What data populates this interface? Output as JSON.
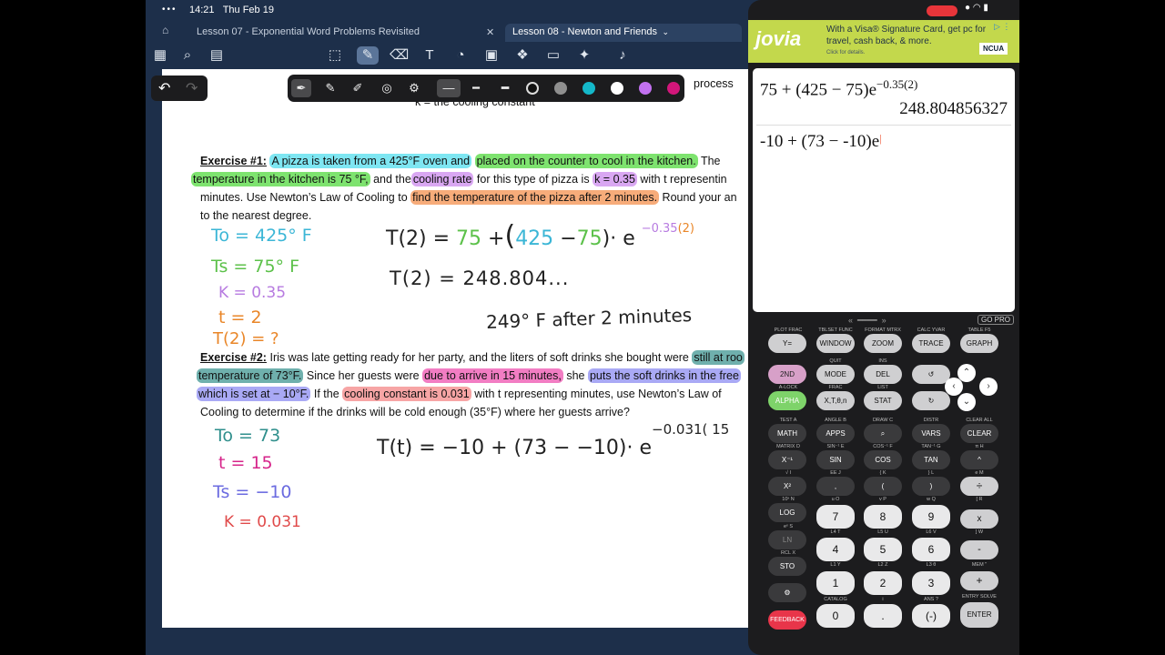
{
  "status": {
    "time": "14:21",
    "date": "Thu Feb 19"
  },
  "tabs": [
    {
      "label": "Lesson 07 - Exponential Word Problems Revisited"
    },
    {
      "label": "Lesson 08 - Newton and Friends"
    }
  ],
  "doc": {
    "top_line_a": "process",
    "top_line_b": "k = the cooling constant",
    "ex1": {
      "label": "Exercise #1:",
      "l1_a": "A pizza is taken from a 425°F oven and",
      "l1_b": "placed on the counter to cool in the kitchen.",
      "l1_c": "The",
      "l2_a": "temperature in the kitchen is 75 °F,",
      "l2_b": "and the",
      "l2_c": "cooling rate",
      "l2_d": "for this type of pizza is",
      "l2_e": "k = 0.35",
      "l2_f": "with t representin",
      "l3_a": "minutes. Use Newton’s Law of Cooling to",
      "l3_b": "find the temperature of the pizza after 2 minutes.",
      "l3_c": "Round your an",
      "l4": "to the nearest degree."
    },
    "ex2": {
      "label": "Exercise #2:",
      "l1_a": "Iris was late getting ready for her party, and the liters of soft drinks she bought were",
      "l1_b": "still at roo",
      "l2_a": "temperature of 73°F.",
      "l2_b": "Since her guests were",
      "l2_c": "due to arrive in 15 minutes,",
      "l2_d": "she",
      "l2_e": "puts the soft drinks in the free",
      "l3_a": "which is set at − 10°F.",
      "l3_b": "If the",
      "l3_c": "cooling constant is 0.031",
      "l3_d": "with t representing minutes, use Newton’s Law of",
      "l4": "Cooling to determine if the drinks will be cold enough (35°F) where her guests arrive?"
    },
    "hw": {
      "t0": "To = 425° F",
      "ts": "Ts = 75° F",
      "k": "K = 0.35",
      "t": "t = 2",
      "t2q": "T(2) = ?",
      "eq1_a": "T(2) =",
      "eq1_b": "75",
      "eq1_c": "+",
      "eq1_d": "(",
      "eq1_e": "425",
      "eq1_f": "−",
      "eq1_g": "75",
      "eq1_h": ")· e",
      "eq1_exp_a": "−0.35",
      "eq1_exp_b": "(2)",
      "eq2": "T(2) = 248.804...",
      "ans": "249° F  after  2 minutes",
      "b_t0": "To = 73",
      "b_t": "t = 15",
      "b_ts": "Ts = −10",
      "b_k": "K = 0.031",
      "eq3": "T(t) = −10 + (73 − −10)· e",
      "eq3_exp": "−0.031( 15"
    }
  },
  "calc": {
    "ad_title": "jovia",
    "ad_text": "With a Visa® Signature Card, get pc for travel, cash back, & more.",
    "ad_sub": "Click for details.",
    "ad_badge": "NCUA",
    "expr1": "75 + (425 − 75)e",
    "expr1_exp": "−0.35(2)",
    "result1": "248.804856327",
    "expr2": "-10 + (73 − -10)e",
    "go_pro": "GO PRO"
  },
  "keys": {
    "y": "Y=",
    "window": "WINDOW",
    "zoom": "ZOOM",
    "trace": "TRACE",
    "graph": "GRAPH",
    "second": "2ND",
    "mode": "MODE",
    "del": "DEL",
    "alpha": "ALPHA",
    "xton": "X,T,θ,n",
    "stat": "STAT",
    "math": "MATH",
    "apps": "APPS",
    "vars": "VARS",
    "clear": "CLEAR",
    "xinv": "X⁻¹",
    "sin": "SIN",
    "cos": "COS",
    "tan": "TAN",
    "pow": "^",
    "xsq": "X²",
    "comma": ",",
    "lparen": "(",
    "rparen": ")",
    "div": "÷",
    "log": "LOG",
    "n7": "7",
    "n8": "8",
    "n9": "9",
    "mul": "x",
    "ln": "LN",
    "n4": "4",
    "n5": "5",
    "n6": "6",
    "sub": "-",
    "sto": "STO",
    "n1": "1",
    "n2": "2",
    "n3": "3",
    "add": "+",
    "n0": "0",
    "dot": ".",
    "neg": "(-)",
    "enter": "ENTER",
    "feedback": "FEEDBACK"
  },
  "sublabels": {
    "plot": "PLOT  FRAC",
    "tblset": "TBLSET  FUNC",
    "format": "FORMAT  MTRX",
    "calc": "CALC  YVAR",
    "table": "TABLE  F5",
    "quit": "QUIT",
    "ins": "INS",
    "alock": "A-LOCK",
    "frac": "FRAC",
    "list": "LIST",
    "test": "TEST  A",
    "angle": "ANGLE  B",
    "draw": "DRAW  C",
    "distr": "DISTR",
    "clearall": "CLEAR ALL",
    "matrix": "MATRIX  D",
    "sininv": "SIN⁻¹  E",
    "cosinv": "COS⁻¹  F",
    "taninv": "TAN⁻¹  G",
    "pi": "π  H",
    "sqrt": "√  I",
    "ee": "EE  J",
    "lbrace": "{  K",
    "rbrace": "}  L",
    "e": "e  M",
    "tenx": "10ˣ  N",
    "u": "u  O",
    "v": "v  P",
    "w": "w  Q",
    "brack": "[  R",
    "ex": "eˣ  S",
    "l4": "L4  T",
    "l5": "L5  U",
    "l6": "L6  V",
    "rbrack": "]  W",
    "rcl": "RCL  X",
    "l1": "L1  Y",
    "l2": "L2  Z",
    "l3": "L3  θ",
    "mem": "MEM  \"",
    "catalog": "CATALOG",
    "i": "i",
    "ans": "ANS  ?",
    "entry": "ENTRY SOLVE"
  }
}
